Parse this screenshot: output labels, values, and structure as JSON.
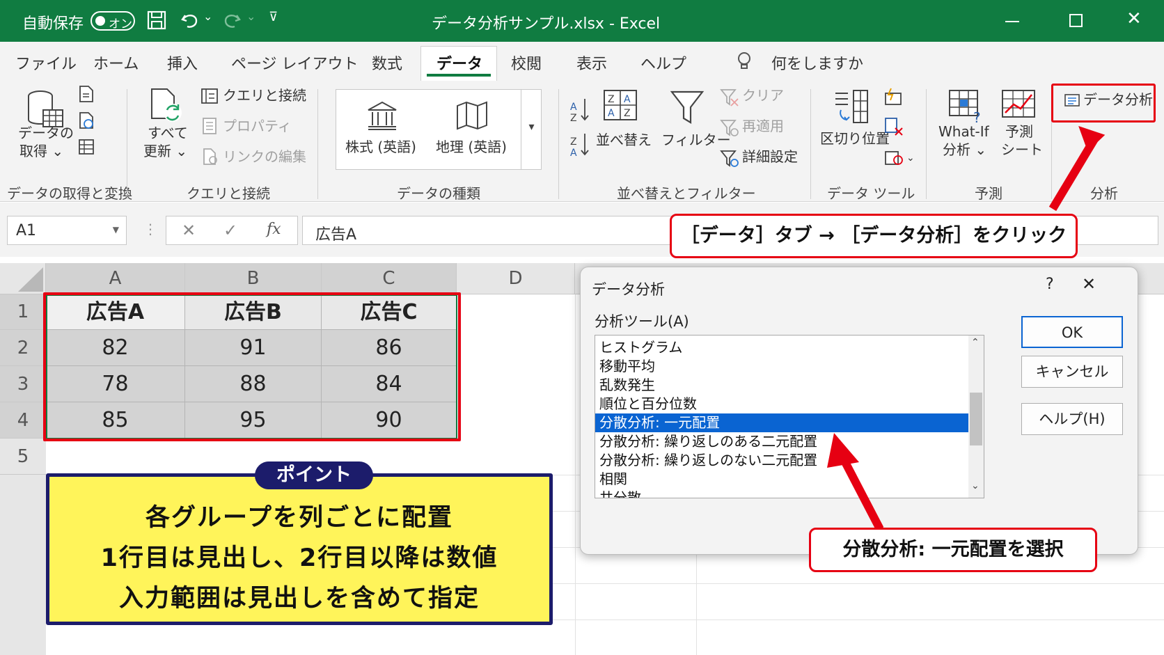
{
  "titlebar": {
    "autosave_label": "自動保存",
    "autosave_state": "オン",
    "file_title": "データ分析サンプル.xlsx  -  Excel"
  },
  "tabs": [
    "ファイル",
    "ホーム",
    "挿入",
    "ページ レイアウト",
    "数式",
    "データ",
    "校閲",
    "表示",
    "ヘルプ"
  ],
  "tell_me": "何をしますか",
  "ribbon": {
    "get_data": [
      "データの",
      "取得 ⌄"
    ],
    "refresh_all": [
      "すべて",
      "更新 ⌄"
    ],
    "queries_connections": "クエリと接続",
    "properties": "プロパティ",
    "edit_links": "リンクの編集",
    "stocks": "株式 (英語)",
    "geography": "地理 (英語)",
    "sort": "並べ替え",
    "filter": "フィルター",
    "clear": "クリア",
    "reapply": "再適用",
    "advanced": "詳細設定",
    "text_to_columns": "区切り位置",
    "what_if": [
      "What-If",
      "分析 ⌄"
    ],
    "forecast_sheet": [
      "予測",
      "シート"
    ],
    "data_analysis": "データ分析",
    "groups": [
      "データの取得と変換",
      "クエリと接続",
      "データの種類",
      "並べ替えとフィルター",
      "データ ツール",
      "予測",
      "分析"
    ]
  },
  "formula_bar": {
    "name_box": "A1",
    "fx": "fx",
    "content": "広告A"
  },
  "sheet": {
    "columns": [
      "A",
      "B",
      "C",
      "D"
    ],
    "rows": [
      "1",
      "2",
      "3",
      "4",
      "5"
    ],
    "headers": [
      "広告A",
      "広告B",
      "広告C"
    ],
    "values": [
      [
        "82",
        "91",
        "86"
      ],
      [
        "78",
        "88",
        "84"
      ],
      [
        "85",
        "95",
        "90"
      ]
    ]
  },
  "dialog": {
    "title": "データ分析",
    "help_mark": "?",
    "close_mark": "✕",
    "tools_label": "分析ツール(A)",
    "tools": [
      "ヒストグラム",
      "移動平均",
      "乱数発生",
      "順位と百分位数",
      "分散分析: 一元配置",
      "分散分析: 繰り返しのある二元配置",
      "分散分析: 繰り返しのない二元配置",
      "相関",
      "共分散"
    ],
    "selected_index": 4,
    "ok": "OK",
    "cancel": "キャンセル",
    "help": "ヘルプ(H)"
  },
  "annotations": {
    "top_callout": "［データ］タブ → ［データ分析］をクリック",
    "select_callout": "分散分析: 一元配置を選択",
    "point_tag": "ポイント",
    "point_lines": [
      "各グループを列ごとに配置",
      "1行目は見出し、2行目以降は数値",
      "入力範囲は見出しを含めて指定"
    ]
  },
  "colors": {
    "excel_green": "#107c41",
    "highlight_red": "#e60012",
    "selection_blue": "#0a64d2",
    "point_yellow": "#fff45a",
    "point_navy": "#1c1c6b"
  }
}
